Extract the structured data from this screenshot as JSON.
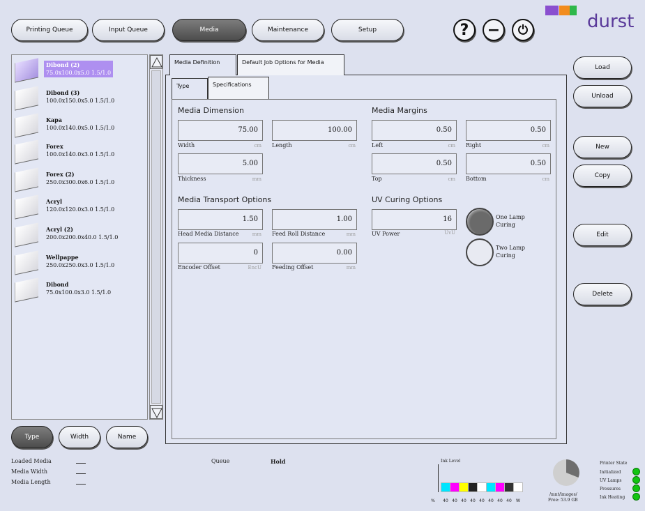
{
  "top_nav": {
    "printing_queue": "Printing Queue",
    "input_queue": "Input Queue",
    "media": "Media",
    "maintenance": "Maintenance",
    "setup": "Setup",
    "help_symbol": "?",
    "minimize_symbol": "−",
    "power_symbol": "⏻"
  },
  "brand": {
    "logo": "durst",
    "bar_colors": [
      "#8a4fcf",
      "#f28c1e",
      "#2eb84a"
    ],
    "accent": "#ae8ff0"
  },
  "media_list": [
    {
      "name": "Dibond (2)",
      "spec": "75.0x100.0x5.0 1.5/1.0",
      "selected": true
    },
    {
      "name": "Dibond (3)",
      "spec": "100.0x150.0x5.0 1.5/1.0"
    },
    {
      "name": "Kapa",
      "spec": "100.0x140.0x5.0 1.5/1.0"
    },
    {
      "name": "Forex",
      "spec": "100.0x140.0x3.0 1.5/1.0"
    },
    {
      "name": "Forex (2)",
      "spec": "250.0x300.0x6.0 1.5/1.0"
    },
    {
      "name": "Acryl",
      "spec": "120.0x120.0x3.0 1.5/1.0"
    },
    {
      "name": "Acryl (2)",
      "spec": "200.0x200.0x40.0 1.5/1.0"
    },
    {
      "name": "Wellpappe",
      "spec": "250.0x250.0x3.0 1.5/1.0"
    },
    {
      "name": "Dibond",
      "spec": "75.0x100.0x3.0 1.5/1.0"
    }
  ],
  "sort_buttons": {
    "type": "Type",
    "width": "Width",
    "name": "Name"
  },
  "tabs": {
    "media_definition": "Media Definition",
    "default_job_options": "Default Job Options for Media",
    "type": "Type",
    "specifications": "Specifications"
  },
  "media_dimension": {
    "title": "Media Dimension",
    "width": {
      "value": "75.00",
      "label": "Width",
      "unit": "cm"
    },
    "length": {
      "value": "100.00",
      "label": "Length",
      "unit": "cm"
    },
    "thickness": {
      "value": "5.00",
      "label": "Thickness",
      "unit": "mm"
    }
  },
  "media_margins": {
    "title": "Media Margins",
    "left": {
      "value": "0.50",
      "label": "Left",
      "unit": "cm"
    },
    "right": {
      "value": "0.50",
      "label": "Right",
      "unit": "cm"
    },
    "top": {
      "value": "0.50",
      "label": "Top",
      "unit": "cm"
    },
    "bottom": {
      "value": "0.50",
      "label": "Bottom",
      "unit": "cm"
    }
  },
  "transport": {
    "title": "Media Transport Options",
    "head_media_distance": {
      "value": "1.50",
      "label": "Head Media Distance",
      "unit": "mm"
    },
    "feed_roll_distance": {
      "value": "1.00",
      "label": "Feed Roll Distance",
      "unit": "mm"
    },
    "encoder_offset": {
      "value": "0",
      "label": "Encoder Offset",
      "unit": "EncU"
    },
    "feeding_offset": {
      "value": "0.00",
      "label": "Feeding Offset",
      "unit": "mm"
    }
  },
  "uv_curing": {
    "title": "UV Curing Options",
    "uv_power": {
      "value": "16",
      "label": "UV Power",
      "unit": "UvU"
    },
    "one_lamp": {
      "line1": "One Lamp",
      "line2": "Curing",
      "selected": true
    },
    "two_lamp": {
      "line1": "Two Lamp",
      "line2": "Curing",
      "selected": false
    }
  },
  "side_buttons": {
    "load": "Load",
    "unload": "Unload",
    "new": "New",
    "copy": "Copy",
    "edit": "Edit",
    "delete": "Delete"
  },
  "status": {
    "loaded_media": "Loaded Media",
    "media_width": "Media Width",
    "media_length": "Media Length",
    "queue_label": "Queue",
    "queue_value": "Hold"
  },
  "ink": {
    "title": "Ink Level",
    "percent_label": "%",
    "colors": [
      "#00e5ff",
      "#ff00ff",
      "#ffff00",
      "#222222",
      "#ffffff",
      "#00e5ff",
      "#ff00ff",
      "#333333",
      "#ffffff"
    ],
    "levels": [
      "40",
      "40",
      "40",
      "40",
      "40",
      "40",
      "40",
      "40",
      "W"
    ]
  },
  "disk": {
    "path": "/mnt/images/",
    "free": "Free: 53.9 GB"
  },
  "printer_state": {
    "title": "Printer State",
    "items": [
      "Initialized",
      "UV Lamps",
      "Pressures",
      "Ink Heating"
    ],
    "led_color": "#12c412"
  }
}
